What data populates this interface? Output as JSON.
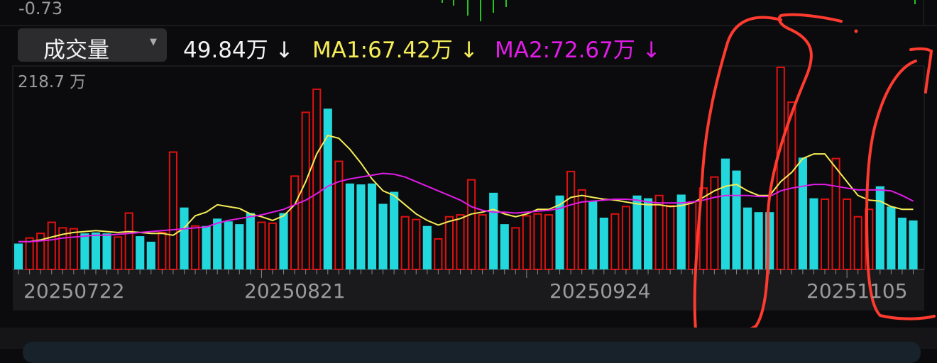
{
  "top_value": "-0.73",
  "indicator": {
    "selected": "成交量",
    "current": "49.84万",
    "current_arrow": "↓",
    "ma1_label": "MA1:67.42万",
    "ma1_arrow": "↓",
    "ma2_label": "MA2:72.67万",
    "ma2_arrow": "↓"
  },
  "colors": {
    "background": "#0b0b0d",
    "up_bar": "#e01010",
    "down_bar": "#22d8dc",
    "ma1": "#f5ec57",
    "ma2": "#e01ce6",
    "grid": "#2a2a2d",
    "annotation": "#ff3b30",
    "top_bars": "#22c522"
  },
  "icons": {
    "dropdown": "triangle-down-icon",
    "arrow": "down-arrow-icon"
  },
  "chart_data": {
    "type": "bar",
    "title": "成交量",
    "unit": "万",
    "ylim": [
      0,
      218.7
    ],
    "y_max_label": "218.7 万",
    "x_tick_labels": [
      "20250722",
      "20250821",
      "20250924",
      "20251105"
    ],
    "bars": {
      "values": [
        28,
        34,
        39,
        51,
        45,
        44,
        39,
        40,
        39,
        35,
        61,
        36,
        30,
        40,
        127,
        67,
        47,
        47,
        55,
        52,
        49,
        61,
        51,
        50,
        61,
        101,
        170,
        195,
        174,
        117,
        93,
        92,
        93,
        71,
        84,
        57,
        54,
        47,
        33,
        57,
        59,
        97,
        59,
        83,
        49,
        45,
        58,
        60,
        59,
        80,
        106,
        86,
        74,
        56,
        60,
        68,
        80,
        77,
        80,
        69,
        81,
        73,
        88,
        100,
        120,
        107,
        67,
        62,
        62,
        221,
        181,
        121,
        77,
        76,
        120,
        76,
        57,
        65,
        90,
        68,
        56,
        53
      ],
      "up": [
        0,
        1,
        1,
        1,
        1,
        1,
        0,
        0,
        0,
        1,
        1,
        0,
        0,
        1,
        1,
        0,
        1,
        0,
        0,
        0,
        0,
        0,
        1,
        1,
        0,
        1,
        1,
        1,
        0,
        1,
        0,
        0,
        0,
        0,
        0,
        1,
        1,
        0,
        1,
        1,
        1,
        1,
        1,
        0,
        0,
        1,
        1,
        1,
        1,
        0,
        1,
        1,
        0,
        0,
        1,
        1,
        0,
        0,
        1,
        1,
        0,
        1,
        1,
        1,
        0,
        0,
        0,
        0,
        0,
        1,
        1,
        0,
        0,
        1,
        1,
        1,
        1,
        1,
        0,
        0,
        0,
        0
      ]
    },
    "series": [
      {
        "name": "MA1",
        "values": [
          30,
          30,
          32,
          35,
          38,
          40,
          41,
          42,
          41,
          40,
          41,
          40,
          39,
          39,
          37,
          45,
          58,
          62,
          70,
          68,
          66,
          60,
          57,
          53,
          58,
          70,
          95,
          125,
          145,
          142,
          130,
          115,
          98,
          85,
          80,
          70,
          60,
          53,
          48,
          52,
          55,
          60,
          62,
          65,
          60,
          57,
          60,
          65,
          65,
          70,
          78,
          80,
          78,
          76,
          75,
          73,
          71,
          70,
          70,
          68,
          69,
          72,
          78,
          85,
          90,
          92,
          85,
          80,
          80,
          95,
          105,
          120,
          125,
          125,
          110,
          95,
          80,
          75,
          74,
          68,
          65,
          65
        ]
      },
      {
        "name": "MA2",
        "values": [
          30,
          30,
          31,
          32,
          34,
          35,
          36,
          37,
          37,
          38,
          39,
          40,
          41,
          42,
          43,
          44,
          45,
          46,
          50,
          53,
          55,
          57,
          59,
          62,
          65,
          70,
          75,
          82,
          90,
          95,
          98,
          100,
          102,
          104,
          103,
          100,
          95,
          90,
          85,
          80,
          75,
          68,
          64,
          62,
          62,
          61,
          62,
          63,
          64,
          66,
          70,
          73,
          74,
          75,
          76,
          76,
          75,
          73,
          72,
          72,
          72,
          73,
          75,
          78,
          80,
          80,
          80,
          79,
          79,
          85,
          88,
          90,
          92,
          92,
          90,
          88,
          86,
          86,
          86,
          85,
          80,
          74
        ]
      }
    ]
  }
}
